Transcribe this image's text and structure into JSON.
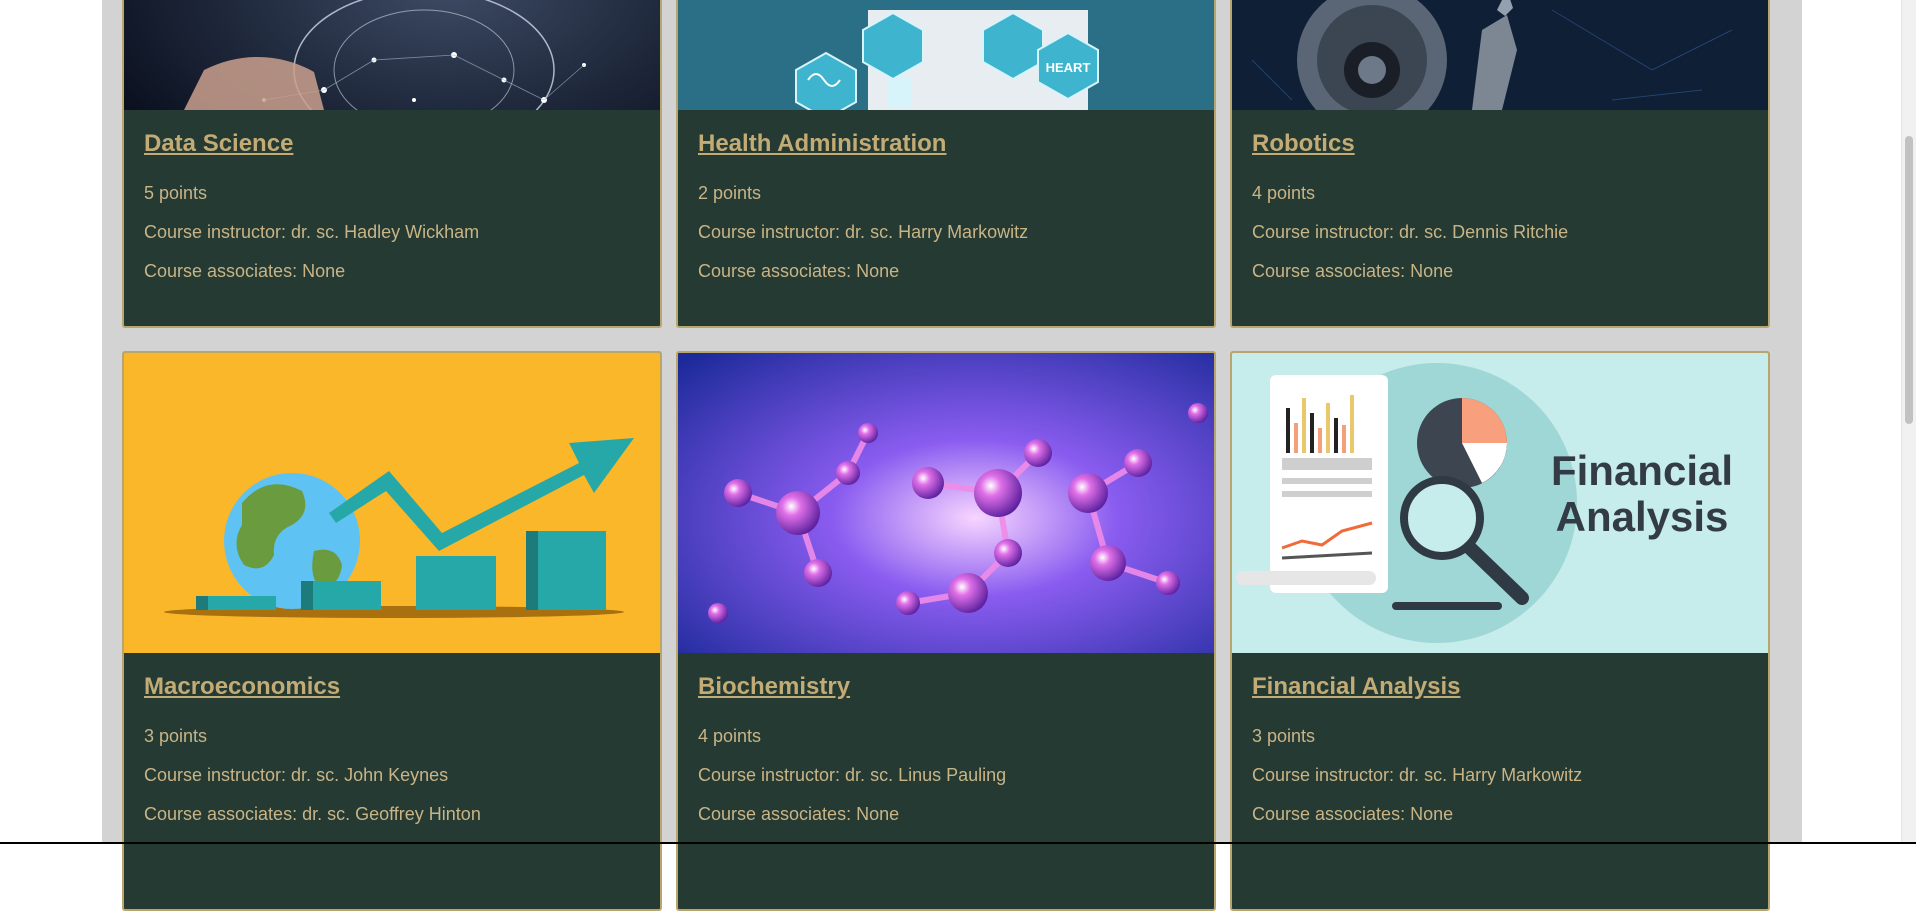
{
  "courses": [
    {
      "title": "Data Science",
      "points": "5 points",
      "instructor": "Course instructor: dr. sc. Hadley Wickham",
      "associates": "Course associates: None"
    },
    {
      "title": "Health Administration",
      "points": "2 points",
      "instructor": "Course instructor: dr. sc. Harry Markowitz",
      "associates": "Course associates: None",
      "image_text": "HEART"
    },
    {
      "title": "Robotics",
      "points": "4 points",
      "instructor": "Course instructor: dr. sc. Dennis Ritchie",
      "associates": "Course associates: None"
    },
    {
      "title": "Macroeconomics",
      "points": "3 points",
      "instructor": "Course instructor: dr. sc. John Keynes",
      "associates": "Course associates: dr. sc. Geoffrey Hinton"
    },
    {
      "title": "Biochemistry",
      "points": "4 points",
      "instructor": "Course instructor: dr. sc. Linus Pauling",
      "associates": "Course associates: None"
    },
    {
      "title": "Financial Analysis",
      "points": "3 points",
      "instructor": "Course instructor: dr. sc. Harry Markowitz",
      "associates": "Course associates: None",
      "image_text_1": "Financial",
      "image_text_2": "Analysis"
    }
  ],
  "colors": {
    "card_bg": "#243a33",
    "card_border": "#b9a56e",
    "title": "#c3ab75",
    "text": "#c9b486",
    "page_bg": "#d3d3d3"
  }
}
